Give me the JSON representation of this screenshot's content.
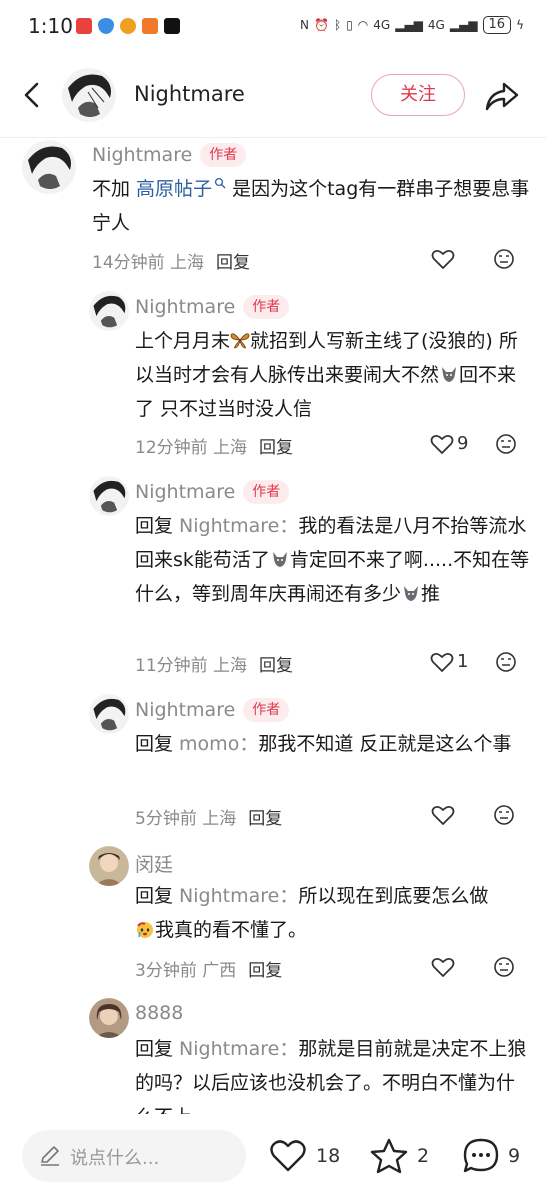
{
  "status_bar": {
    "time": "1:10",
    "battery": "16",
    "signal": "4G",
    "app_icons": [
      "vivo-icon",
      "shield-icon",
      "weibo-icon",
      "app-orange-icon",
      "tiktok-icon"
    ]
  },
  "header": {
    "title": "Nightmare",
    "follow_label": "关注"
  },
  "comments": [
    {
      "name": "Nightmare",
      "badge": "作者",
      "text_before": "不加 ",
      "link": "高原帖子",
      "text_after": " 是因为这个tag有一群串子想要息事宁人",
      "time": "14分钟前",
      "location": "上海",
      "reply": "回复",
      "likes": ""
    },
    {
      "name": "Nightmare",
      "badge": "作者",
      "text_1": "上个月月末",
      "text_2": "就招到人写新主线了(没狼的) 所以当时才会有人脉传出来要闹大不然",
      "text_3": "回不来了 只不过当时没人信",
      "time": "12分钟前",
      "location": "上海",
      "reply": "回复",
      "likes": "9"
    },
    {
      "name": "Nightmare",
      "badge": "作者",
      "reply_prefix": "回复 ",
      "reply_to": "Nightmare：",
      "text_1": "我的看法是八月不抬等流水回来sk能苟活了",
      "text_2": "肯定回不来了啊.....不知在等什么，等到周年庆再闹还有多少",
      "text_3": "推",
      "time": "11分钟前",
      "location": "上海",
      "reply": "回复",
      "likes": "1"
    },
    {
      "name": "Nightmare",
      "badge": "作者",
      "reply_prefix": "回复 ",
      "reply_to": "momo：",
      "text": "那我不知道 反正就是这么个事",
      "time": "5分钟前",
      "location": "上海",
      "reply": "回复",
      "likes": ""
    },
    {
      "name": "闵廷",
      "reply_prefix": "回复 ",
      "reply_to": "Nightmare：",
      "text_1": "所以现在到底要怎么做",
      "text_2": "我真的看不懂了。",
      "time": "3分钟前",
      "location": "广西",
      "reply": "回复",
      "likes": ""
    },
    {
      "name": "8888",
      "reply_prefix": "回复 ",
      "reply_to": "Nightmare：",
      "text": "那就是目前就是决定不上狼的吗？以后应该也没机会了。不明白不懂为什么不上"
    }
  ],
  "bottom_bar": {
    "placeholder": "说点什么...",
    "likes": "18",
    "stars": "2",
    "comments": "9"
  },
  "colors": {
    "accent": "#e0384d",
    "link": "#2d5fa0",
    "badge_bg": "#fdecee"
  }
}
